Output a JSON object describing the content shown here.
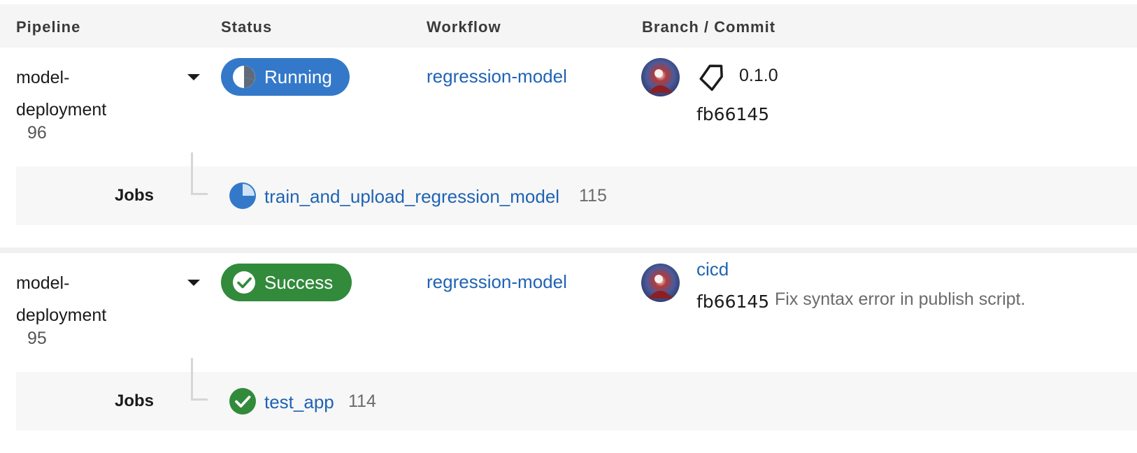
{
  "header": {
    "pipeline": "Pipeline",
    "status": "Status",
    "workflow": "Workflow",
    "branch_commit": "Branch / Commit"
  },
  "colors": {
    "running": "#3479c9",
    "success": "#328a3b",
    "link": "#1f63b4"
  },
  "pipelines": [
    {
      "name": "model-deployment",
      "number": "96",
      "status": "Running",
      "status_icon": "running-pie-icon",
      "workflow": "regression-model",
      "tag": "0.1.0",
      "commit": "fb66145",
      "jobs_label": "Jobs",
      "job": {
        "name": "train_and_upload_regression_model",
        "number": "115",
        "icon": "running-pie-icon"
      }
    },
    {
      "name": "model-deployment",
      "number": "95",
      "status": "Success",
      "status_icon": "check-circle-icon",
      "workflow": "regression-model",
      "branch": "cicd",
      "commit": "fb66145",
      "commit_message": "Fix syntax error in publish script.",
      "jobs_label": "Jobs",
      "job": {
        "name": "test_app",
        "number": "114",
        "icon": "check-circle-icon"
      }
    }
  ]
}
